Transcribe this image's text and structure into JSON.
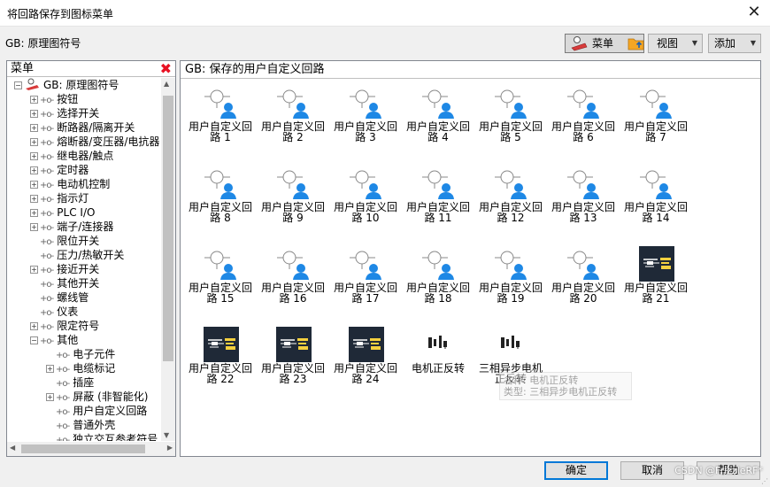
{
  "window": {
    "title": "将回路保存到图标菜单"
  },
  "gb_label": "GB: 原理图符号",
  "toolbar": {
    "menu": "菜单",
    "view": "视图",
    "add": "添加"
  },
  "left": {
    "header": "菜单",
    "tree": [
      {
        "label": "GB: 原理图符号",
        "level": 0,
        "expander": "minus"
      },
      {
        "label": "按钮",
        "level": 1,
        "expander": "plus"
      },
      {
        "label": "选择开关",
        "level": 1,
        "expander": "plus"
      },
      {
        "label": "断路器/隔离开关",
        "level": 1,
        "expander": "plus"
      },
      {
        "label": "熔断器/变压器/电抗器",
        "level": 1,
        "expander": "plus"
      },
      {
        "label": "继电器/触点",
        "level": 1,
        "expander": "plus"
      },
      {
        "label": "定时器",
        "level": 1,
        "expander": "plus"
      },
      {
        "label": "电动机控制",
        "level": 1,
        "expander": "plus"
      },
      {
        "label": "指示灯",
        "level": 1,
        "expander": "plus"
      },
      {
        "label": "PLC I/O",
        "level": 1,
        "expander": "plus"
      },
      {
        "label": "端子/连接器",
        "level": 1,
        "expander": "plus"
      },
      {
        "label": "限位开关",
        "level": 1,
        "expander": "none"
      },
      {
        "label": "压力/热敏开关",
        "level": 1,
        "expander": "none"
      },
      {
        "label": "接近开关",
        "level": 1,
        "expander": "plus"
      },
      {
        "label": "其他开关",
        "level": 1,
        "expander": "none"
      },
      {
        "label": "螺线管",
        "level": 1,
        "expander": "none"
      },
      {
        "label": "仪表",
        "level": 1,
        "expander": "none"
      },
      {
        "label": "限定符号",
        "level": 1,
        "expander": "plus"
      },
      {
        "label": "其他",
        "level": 1,
        "expander": "minus"
      },
      {
        "label": "电子元件",
        "level": 2,
        "expander": "none"
      },
      {
        "label": "电缆标记",
        "level": 2,
        "expander": "plus"
      },
      {
        "label": "插座",
        "level": 2,
        "expander": "none"
      },
      {
        "label": "屏蔽 (非智能化)",
        "level": 2,
        "expander": "plus"
      },
      {
        "label": "用户自定义回路",
        "level": 2,
        "expander": "none"
      },
      {
        "label": "普通外壳",
        "level": 2,
        "expander": "none"
      },
      {
        "label": "独立交互参考符号",
        "level": 2,
        "expander": "none"
      }
    ]
  },
  "right": {
    "header": "GB: 保存的用户自定义回路",
    "items": [
      {
        "line1": "用户自定义回",
        "line2": "路 1",
        "icon": "user-circuit-icon"
      },
      {
        "line1": "用户自定义回",
        "line2": "路 2",
        "icon": "user-circuit-icon"
      },
      {
        "line1": "用户自定义回",
        "line2": "路 3",
        "icon": "user-circuit-icon"
      },
      {
        "line1": "用户自定义回",
        "line2": "路 4",
        "icon": "user-circuit-icon"
      },
      {
        "line1": "用户自定义回",
        "line2": "路 5",
        "icon": "user-circuit-icon"
      },
      {
        "line1": "用户自定义回",
        "line2": "路 6",
        "icon": "user-circuit-icon"
      },
      {
        "line1": "用户自定义回",
        "line2": "路 7",
        "icon": "user-circuit-icon"
      },
      {
        "line1": "用户自定义回",
        "line2": "路 8",
        "icon": "user-circuit-icon"
      },
      {
        "line1": "用户自定义回",
        "line2": "路 9",
        "icon": "user-circuit-icon"
      },
      {
        "line1": "用户自定义回",
        "line2": "路 10",
        "icon": "user-circuit-icon"
      },
      {
        "line1": "用户自定义回",
        "line2": "路 11",
        "icon": "user-circuit-icon"
      },
      {
        "line1": "用户自定义回",
        "line2": "路 12",
        "icon": "user-circuit-icon"
      },
      {
        "line1": "用户自定义回",
        "line2": "路 13",
        "icon": "user-circuit-icon"
      },
      {
        "line1": "用户自定义回",
        "line2": "路 14",
        "icon": "user-circuit-icon"
      },
      {
        "line1": "用户自定义回",
        "line2": "路 15",
        "icon": "user-circuit-icon"
      },
      {
        "line1": "用户自定义回",
        "line2": "路 16",
        "icon": "user-circuit-icon"
      },
      {
        "line1": "用户自定义回",
        "line2": "路 17",
        "icon": "user-circuit-icon"
      },
      {
        "line1": "用户自定义回",
        "line2": "路 18",
        "icon": "user-circuit-icon"
      },
      {
        "line1": "用户自定义回",
        "line2": "路 19",
        "icon": "user-circuit-icon"
      },
      {
        "line1": "用户自定义回",
        "line2": "路 20",
        "icon": "user-circuit-icon"
      },
      {
        "line1": "用户自定义回",
        "line2": "路 21",
        "icon": "circuit-thumbnail-icon"
      },
      {
        "line1": "用户自定义回",
        "line2": "路 22",
        "icon": "circuit-thumbnail-icon"
      },
      {
        "line1": "用户自定义回",
        "line2": "路 23",
        "icon": "circuit-thumbnail-icon"
      },
      {
        "line1": "用户自定义回",
        "line2": "路 24",
        "icon": "circuit-thumbnail-icon"
      },
      {
        "line1": "电机正反转",
        "line2": "",
        "icon": "motor-circuit-icon"
      },
      {
        "line1": "三相异步电机",
        "line2": "正反转",
        "icon": "motor-circuit-icon"
      }
    ],
    "tooltip": {
      "line1": "名称: 电机正反转",
      "line2": "类型: 三相异步电机正反转"
    }
  },
  "buttons": {
    "ok": "确定",
    "cancel": "取消",
    "help": "帮助"
  },
  "watermark": "CSDN @FrizzleRF*"
}
